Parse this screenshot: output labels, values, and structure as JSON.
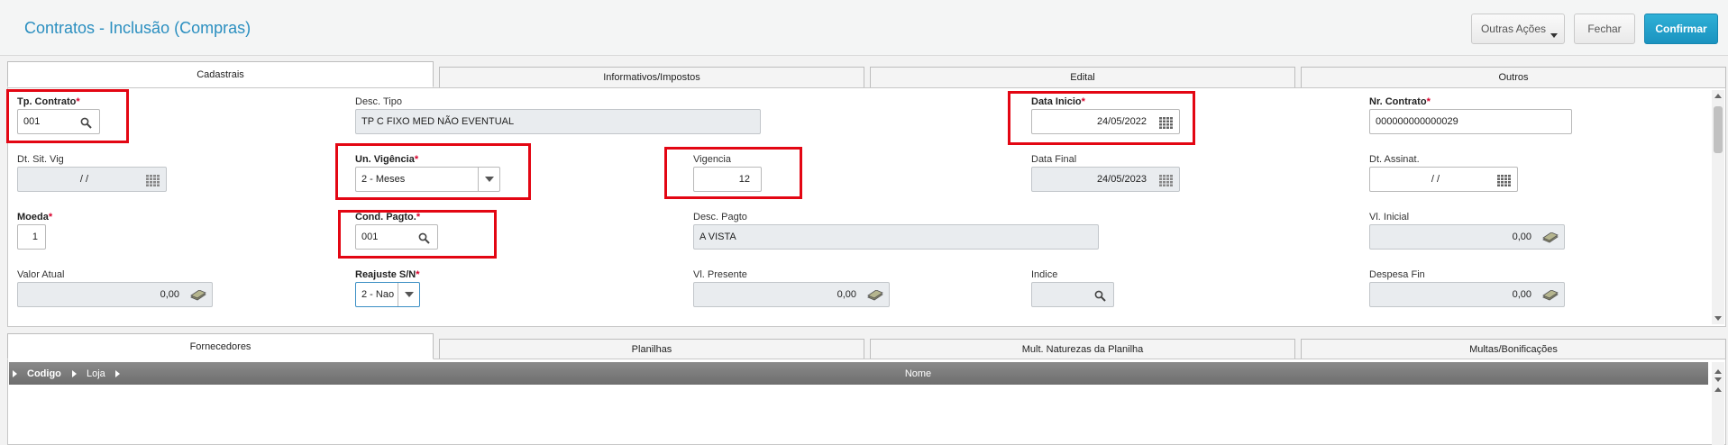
{
  "header": {
    "title": "Contratos - Inclusão (Compras)",
    "more_actions": "Outras Ações",
    "close": "Fechar",
    "confirm": "Confirmar"
  },
  "top_tabs": [
    "Cadastrais",
    "Informativos/Impostos",
    "Edital",
    "Outros"
  ],
  "fields": {
    "tp_contrato": {
      "label": "Tp. Contrato",
      "value": "001"
    },
    "desc_tipo": {
      "label": "Desc. Tipo",
      "value": "TP C FIXO MED NÃO EVENTUAL"
    },
    "data_inicio": {
      "label": "Data Inicio",
      "value": "24/05/2022"
    },
    "nr_contrato": {
      "label": "Nr. Contrato",
      "value": "000000000000029"
    },
    "dt_sit_vig": {
      "label": "Dt. Sit. Vig",
      "value": "/ /"
    },
    "un_vigencia": {
      "label": "Un. Vigência",
      "value": "2 - Meses"
    },
    "vigencia": {
      "label": "Vigencia",
      "value": "12"
    },
    "data_final": {
      "label": "Data Final",
      "value": "24/05/2023"
    },
    "dt_assinat": {
      "label": "Dt. Assinat.",
      "value": "/ /"
    },
    "moeda": {
      "label": "Moeda",
      "value": "1"
    },
    "cond_pagto": {
      "label": "Cond. Pagto.",
      "value": "001"
    },
    "desc_pagto": {
      "label": "Desc. Pagto",
      "value": "A VISTA"
    },
    "vl_inicial": {
      "label": "Vl. Inicial",
      "value": "0,00"
    },
    "valor_atual": {
      "label": "Valor Atual",
      "value": "0,00"
    },
    "reajuste": {
      "label": "Reajuste S/N",
      "value": "2 - Nao"
    },
    "vl_presente": {
      "label": "Vl. Presente",
      "value": "0,00"
    },
    "indice": {
      "label": "Indice",
      "value": ""
    },
    "despesa_fin": {
      "label": "Despesa Fin",
      "value": "0,00"
    }
  },
  "bottom_tabs": [
    "Fornecedores",
    "Planilhas",
    "Mult. Naturezas da Planilha",
    "Multas/Bonificações"
  ],
  "grid": {
    "columns": [
      "Codigo",
      "Loja",
      "Nome"
    ]
  },
  "colors": {
    "accent": "#2b8fc0",
    "required": "#d8002c",
    "highlight": "#e30613",
    "primary_button": "#1a93c0"
  }
}
